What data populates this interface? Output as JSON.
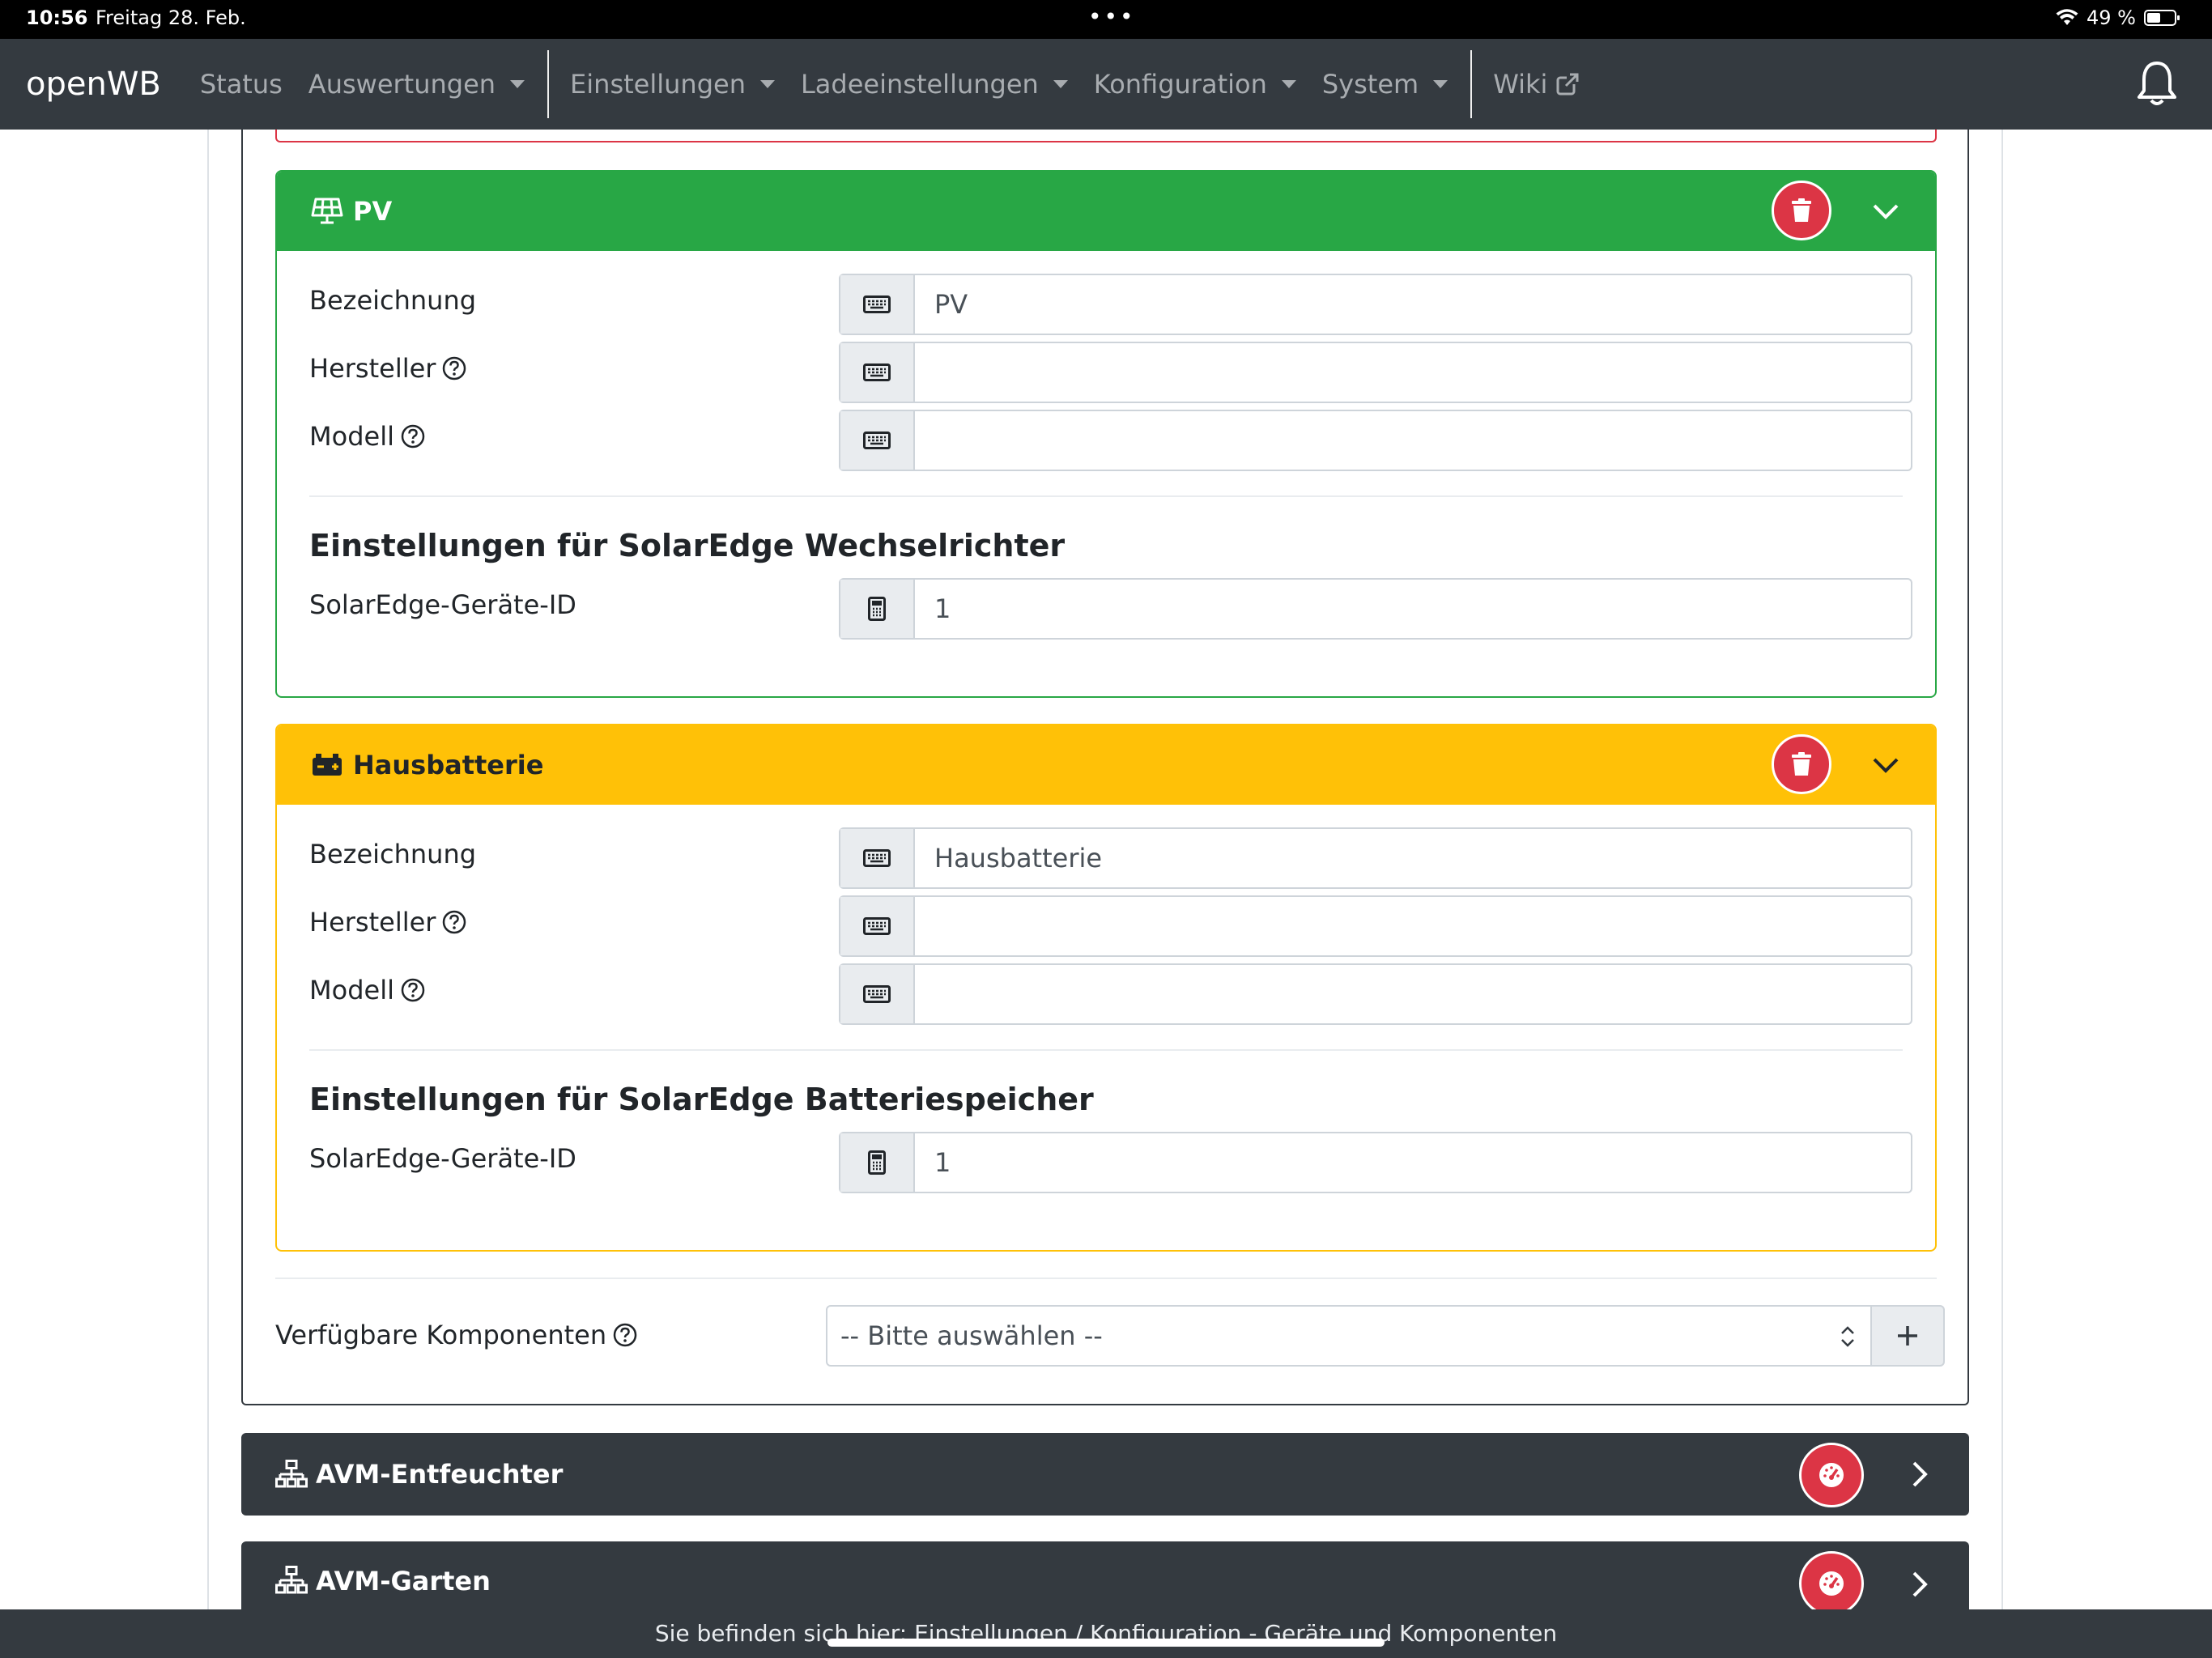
{
  "status_bar": {
    "time": "10:56",
    "date": "Freitag 28. Feb.",
    "battery": "49 %"
  },
  "nav": {
    "brand": "openWB",
    "items": [
      {
        "label": "Status",
        "dropdown": false
      },
      {
        "label": "Auswertungen",
        "dropdown": true
      },
      {
        "label": "Einstellungen",
        "dropdown": true
      },
      {
        "label": "Ladeeinstellungen",
        "dropdown": true
      },
      {
        "label": "Konfiguration",
        "dropdown": true
      },
      {
        "label": "System",
        "dropdown": true
      },
      {
        "label": "Wiki",
        "dropdown": false
      }
    ]
  },
  "components": [
    {
      "title": "PV",
      "icon": "solar-panel-icon",
      "color": "#28a745",
      "fields": {
        "bezeichnung_label": "Bezeichnung",
        "bezeichnung_value": "PV",
        "hersteller_label": "Hersteller",
        "hersteller_value": "",
        "modell_label": "Modell",
        "modell_value": ""
      },
      "section_title": "Einstellungen für SolarEdge Wechselrichter",
      "device_id_label": "SolarEdge-Geräte-ID",
      "device_id_value": "1"
    },
    {
      "title": "Hausbatterie",
      "icon": "car-battery-icon",
      "color": "#ffc107",
      "fields": {
        "bezeichnung_label": "Bezeichnung",
        "bezeichnung_value": "Hausbatterie",
        "hersteller_label": "Hersteller",
        "hersteller_value": "",
        "modell_label": "Modell",
        "modell_value": ""
      },
      "section_title": "Einstellungen für SolarEdge Batteriespeicher",
      "device_id_label": "SolarEdge-Geräte-ID",
      "device_id_value": "1"
    }
  ],
  "available": {
    "label": "Verfügbare Komponenten",
    "select_value": "-- Bitte auswählen --"
  },
  "devices": [
    {
      "title": "AVM-Entfeuchter",
      "icon": "network-icon"
    },
    {
      "title": "AVM-Garten",
      "icon": "network-icon"
    }
  ],
  "footer": {
    "text": "Sie befinden sich hier: Einstellungen / Konfiguration - Geräte und Komponenten"
  },
  "colors": {
    "navbar": "#343a40",
    "danger": "#dc3545",
    "success": "#28a745",
    "warning": "#ffc107"
  }
}
